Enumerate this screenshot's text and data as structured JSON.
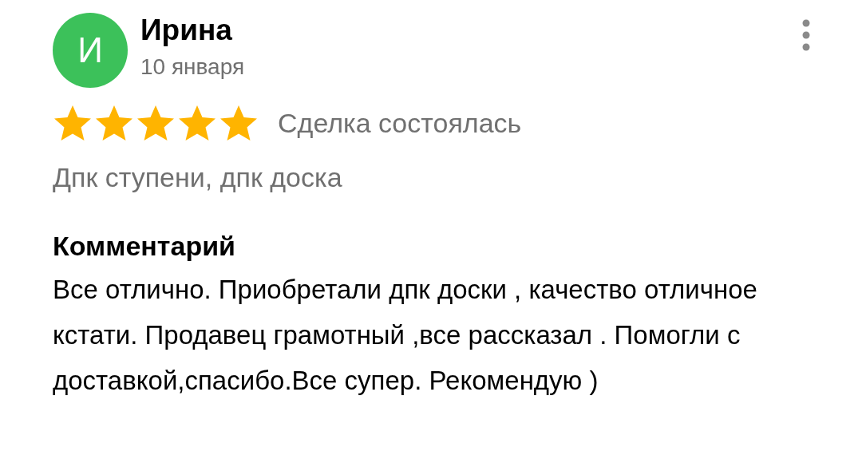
{
  "review": {
    "avatar_letter": "И",
    "author": "Ирина",
    "date": "10 января",
    "stars": 5,
    "status": "Сделка состоялась",
    "products": "Дпк ступени, дпк доска",
    "comment_heading": "Комментарий",
    "comment": "Все отлично. Приобретали дпк доски , качество отличное кстати. Продавец грамотный ,все рассказал . Помогли с доставкой,спасибо.Все супер. Рекомендую )"
  }
}
